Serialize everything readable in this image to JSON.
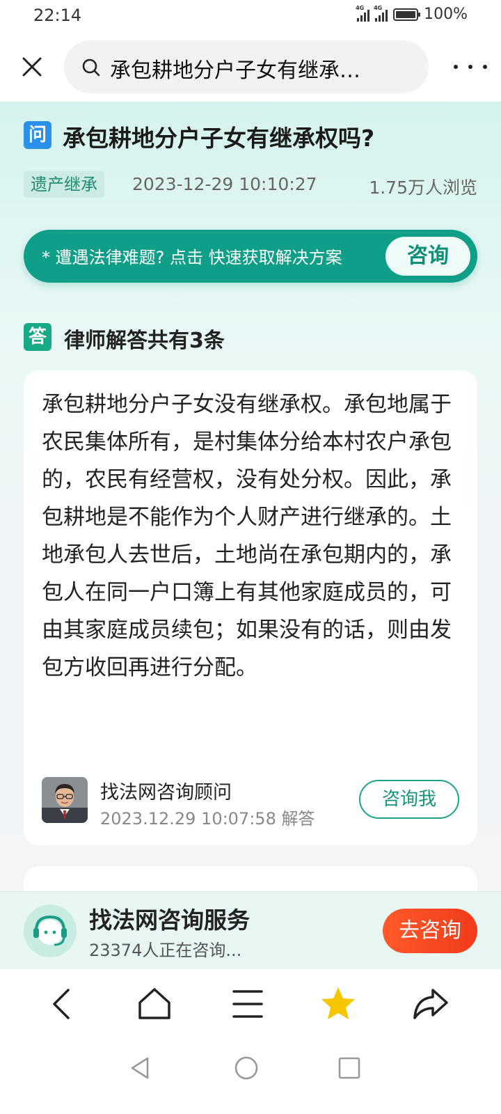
{
  "status_bar": {
    "time": "22:14",
    "network_1": "4G",
    "network_2": "4G",
    "battery": "100%"
  },
  "top_bar": {
    "search_text": "承包耕地分户子女有继承…"
  },
  "question": {
    "badge": "问",
    "title": "承包耕地分户子女有继承权吗?",
    "tag": "遗产继承",
    "date": "2023-12-29 10:10:27",
    "views": "1.75万人浏览"
  },
  "cta": {
    "text": "* 遭遇法律难题? 点击 快速获取解决方案",
    "button": "咨询"
  },
  "answers": {
    "badge": "答",
    "heading": "律师解答共有3条",
    "items": [
      {
        "text": "承包耕地分户子女没有继承权。承包地属于农民集体所有，是村集体分给本村农户承包的，农民有经营权，没有处分权。因此，承包耕地是不能作为个人财产进行继承的。土地承包人去世后，土地尚在承包期内的，承包人在同一户口簿上有其他家庭成员的，可由其家庭成员续包；如果没有的话，则由发包方收回再进行分配。",
        "author": "找法网咨询顾问",
        "time": "2023.12.29 10:07:58 解答",
        "button": "咨询我"
      }
    ]
  },
  "service_bar": {
    "title": "找法网咨询服务",
    "subtitle": "23374人正在咨询...",
    "button": "去咨询"
  },
  "colors": {
    "accent": "#0f9f88",
    "question_badge": "#2a90e8",
    "orange_button": "#f4511e",
    "star": "#f7c600"
  },
  "icons": {
    "top_bar": [
      "close-icon",
      "search-icon",
      "more-icon"
    ],
    "bottom_nav": [
      "back-icon",
      "home-icon",
      "menu-icon",
      "star-icon",
      "share-icon"
    ],
    "system_nav": [
      "triangle-back-icon",
      "circle-home-icon",
      "square-recents-icon"
    ]
  }
}
